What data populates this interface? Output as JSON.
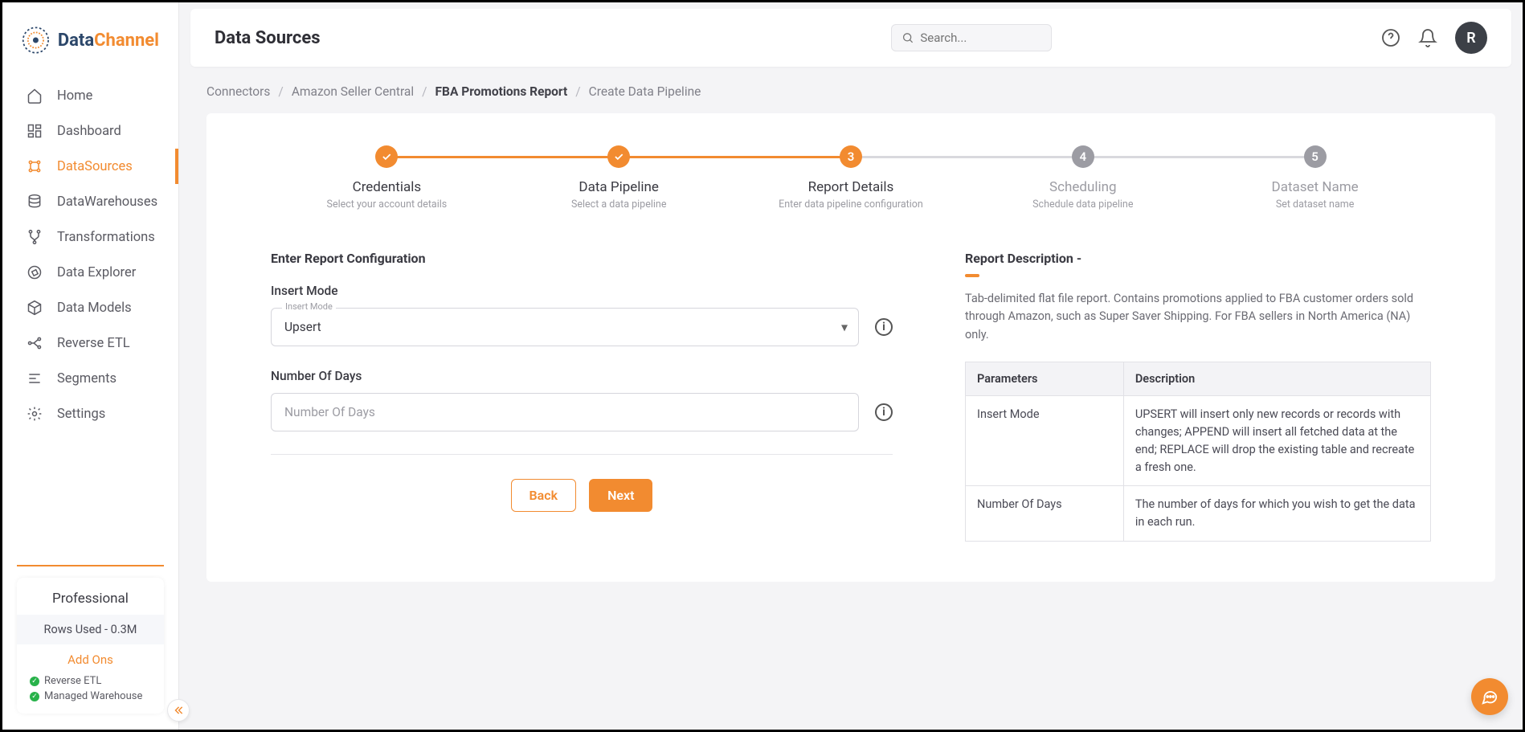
{
  "brand": {
    "part1": "Data",
    "part2": "Channel"
  },
  "sidebar": {
    "items": [
      {
        "label": "Home"
      },
      {
        "label": "Dashboard"
      },
      {
        "label": "DataSources"
      },
      {
        "label": "DataWarehouses"
      },
      {
        "label": "Transformations"
      },
      {
        "label": "Data Explorer"
      },
      {
        "label": "Data Models"
      },
      {
        "label": "Reverse ETL"
      },
      {
        "label": "Segments"
      },
      {
        "label": "Settings"
      }
    ],
    "plan": {
      "title": "Professional",
      "rows": "Rows Used - 0.3M",
      "addons_label": "Add Ons",
      "addons": [
        "Reverse ETL",
        "Managed Warehouse"
      ]
    }
  },
  "header": {
    "title": "Data Sources",
    "search_placeholder": "Search...",
    "avatar_initial": "R"
  },
  "breadcrumb": [
    "Connectors",
    "Amazon Seller Central",
    "FBA Promotions Report",
    "Create Data Pipeline"
  ],
  "stepper": [
    {
      "title": "Credentials",
      "sub": "Select your account details",
      "state": "done"
    },
    {
      "title": "Data Pipeline",
      "sub": "Select a data pipeline",
      "state": "done"
    },
    {
      "title": "Report Details",
      "sub": "Enter data pipeline configuration",
      "state": "current",
      "num": "3"
    },
    {
      "title": "Scheduling",
      "sub": "Schedule data pipeline",
      "state": "pending",
      "num": "4"
    },
    {
      "title": "Dataset Name",
      "sub": "Set dataset name",
      "state": "pending",
      "num": "5"
    }
  ],
  "form": {
    "section_title": "Enter Report Configuration",
    "insert_mode_label": "Insert Mode",
    "insert_mode_float": "Insert Mode",
    "insert_mode_value": "Upsert",
    "number_of_days_label": "Number Of Days",
    "number_of_days_placeholder": "Number Of Days",
    "back_label": "Back",
    "next_label": "Next"
  },
  "description": {
    "title": "Report Description -",
    "text": "Tab-delimited flat file report. Contains promotions applied to FBA customer orders sold through Amazon, such as Super Saver Shipping. For FBA sellers in North America (NA) only.",
    "table": {
      "headers": [
        "Parameters",
        "Description"
      ],
      "rows": [
        [
          "Insert Mode",
          "UPSERT will insert only new records or records with changes; APPEND will insert all fetched data at the end; REPLACE will drop the existing table and recreate a fresh one."
        ],
        [
          "Number Of Days",
          "The number of days for which you wish to get the data in each run."
        ]
      ]
    }
  }
}
